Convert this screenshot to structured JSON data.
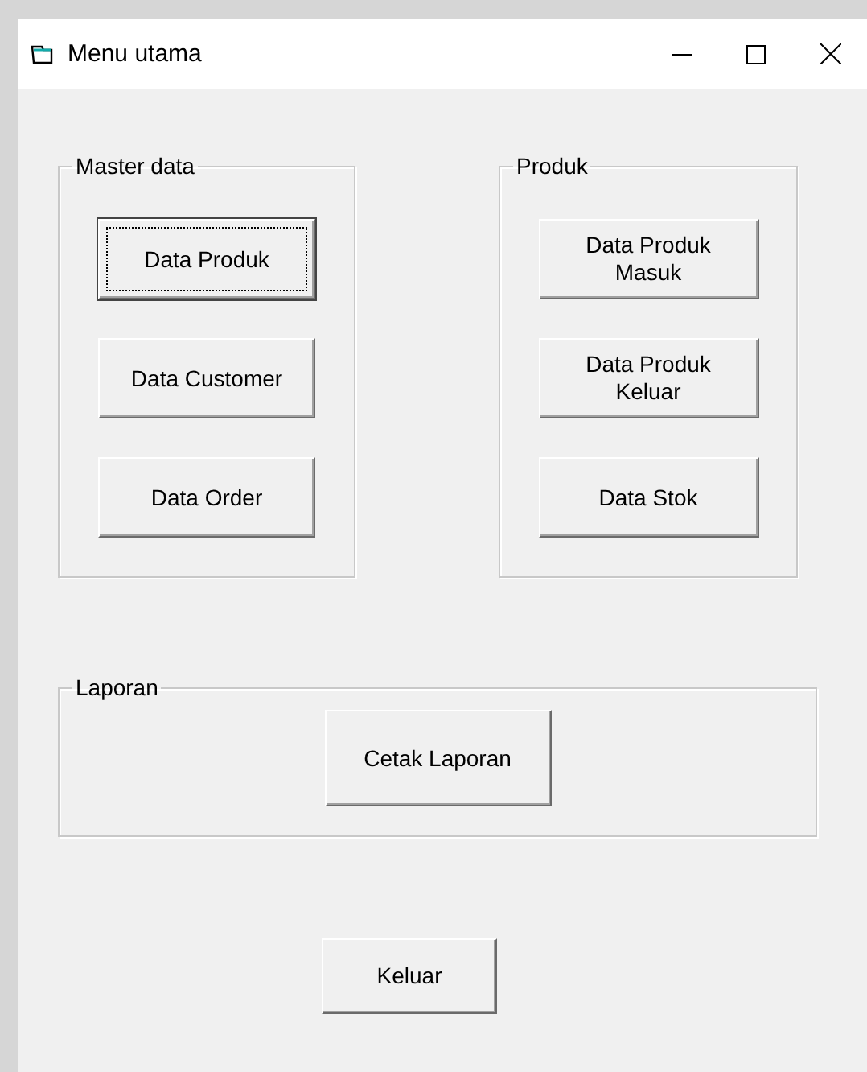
{
  "window": {
    "title": "Menu utama"
  },
  "groups": [
    {
      "label": "Master data",
      "buttons": [
        {
          "label": "Data Produk",
          "focused": true
        },
        {
          "label": "Data Customer",
          "focused": false
        },
        {
          "label": "Data Order",
          "focused": false
        }
      ]
    },
    {
      "label": "Produk",
      "buttons": [
        {
          "label": "Data Produk\nMasuk",
          "focused": false
        },
        {
          "label": "Data Produk\nKeluar",
          "focused": false
        },
        {
          "label": "Data Stok",
          "focused": false
        }
      ]
    }
  ],
  "report_group": {
    "label": "Laporan",
    "button": {
      "label": "Cetak Laporan",
      "focused": false
    }
  },
  "exit_button": {
    "label": "Keluar",
    "focused": false
  }
}
